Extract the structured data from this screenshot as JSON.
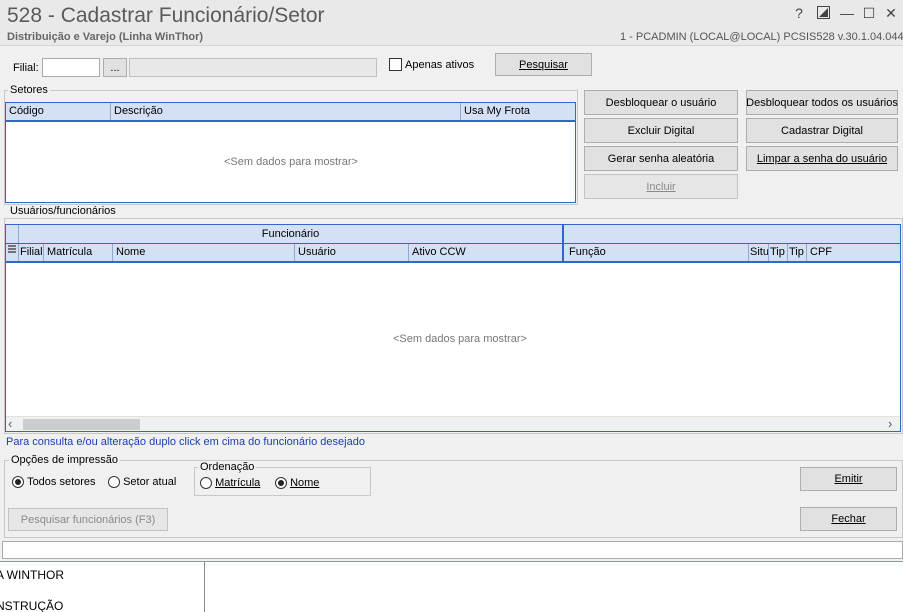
{
  "window": {
    "title": "528 - Cadastrar Funcionário/Setor",
    "subtitle": "Distribuição e Varejo (Linha WinThor)",
    "sysinfo": "1 - PCADMIN (LOCAL@LOCAL)   PCSIS528  v.30.1.04.044",
    "help_glyph": "?",
    "minimize_glyph": "—",
    "maximize_glyph": "☐",
    "close_glyph": "✕"
  },
  "filter": {
    "filial_label": "Filial:",
    "filial_value": "",
    "browse_label": "...",
    "filial_desc": "",
    "apenas_ativos_label": "Apenas ativos",
    "apenas_ativos_checked": false,
    "pesquisar_label": "Pesquisar"
  },
  "setores": {
    "title": "Setores",
    "columns": [
      "Código",
      "Descrição",
      "Usa My Frota"
    ],
    "empty_text": "<Sem dados para mostrar>"
  },
  "actions": {
    "desbloquear_usuario": "Desbloquear o usuário",
    "desbloquear_todos": "Desbloquear todos os usuários",
    "excluir_digital": "Excluir Digital",
    "cadastrar_digital": "Cadastrar Digital",
    "gerar_senha": "Gerar senha aleatória",
    "limpar_senha": "Limpar a senha do usuário",
    "incluir": "Incluir"
  },
  "usuarios": {
    "title": "Usuários/funcionários",
    "band_funcionario": "Funcionário",
    "band_right": "",
    "columns": [
      "Filial",
      "Matrícula",
      "Nome",
      "Usuário",
      "Ativo CCW",
      "Função",
      "Situ",
      "Tip",
      "Tip",
      "CPF"
    ],
    "empty_text": "<Sem dados para mostrar>",
    "scroll_left": "‹",
    "scroll_right": "›"
  },
  "hint": {
    "text": "Para consulta e/ou alteração duplo click em cima do funcionário desejado"
  },
  "impressao": {
    "title": "Opções de impressão",
    "todos_setores": "Todos setores",
    "setor_atual": "Setor atual",
    "selected": "todos_setores",
    "ordenacao_title": "Ordenação",
    "matricula": "Matrícula",
    "nome": "Nome",
    "order_selected": "nome",
    "emitir": "Emitir",
    "pesquisar_func": "Pesquisar funcionários (F3)",
    "fechar": "Fechar"
  },
  "bottom": {
    "status_value": "",
    "item1": "A WINTHOR",
    "item2": "NSTRUÇÃO"
  }
}
